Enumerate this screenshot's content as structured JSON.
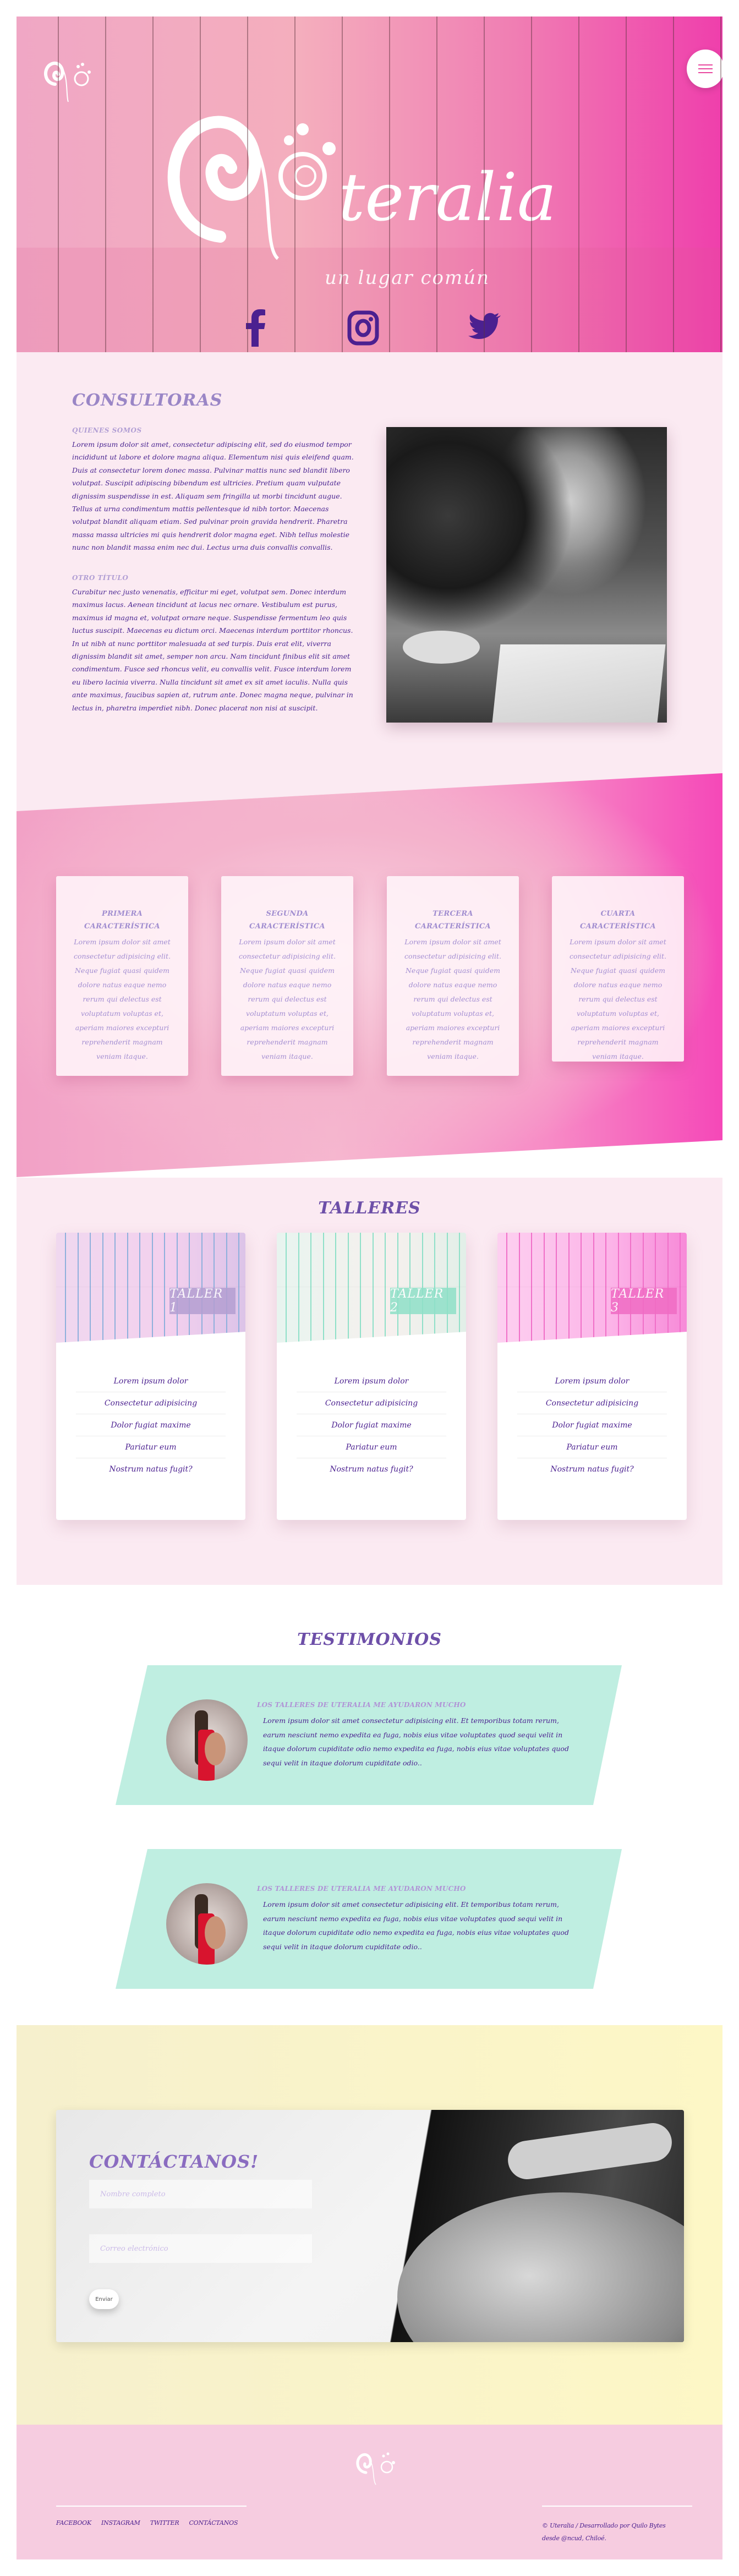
{
  "colors": {
    "accent_purple": "#4a1f8f",
    "heading_lilac": "#9a86c6",
    "hero_pink": "#ef3fac",
    "mint": "#bfeee1",
    "footer_pink": "#f6cce0"
  },
  "hero": {
    "brand": "teralia",
    "tagline": "un lugar común",
    "menu_icon": "hamburger-icon",
    "social": [
      {
        "icon": "facebook-icon"
      },
      {
        "icon": "instagram-icon"
      },
      {
        "icon": "twitter-icon"
      }
    ]
  },
  "consultoras": {
    "title": "CONSULTORAS",
    "sub1": "QUIENES SOMOS",
    "p1": "Lorem ipsum dolor sit amet, consectetur adipiscing elit, sed do eiusmod tempor incididunt ut labore et dolore magna aliqua. Elementum nisi quis eleifend quam. Duis at consectetur lorem donec massa. Pulvinar mattis nunc sed blandit libero volutpat. Suscipit adipiscing bibendum est ultricies. Pretium quam vulputate dignissim suspendisse in est. Aliquam sem fringilla ut morbi tincidunt augue. Tellus at urna condimentum mattis pellentesque id nibh tortor. Maecenas volutpat blandit aliquam etiam. Sed pulvinar proin gravida hendrerit. Pharetra massa massa ultricies mi quis hendrerit dolor magna eget. Nibh tellus molestie nunc non blandit massa enim nec dui. Lectus urna duis convallis convallis.",
    "sub2": "OTRO TÍTULO",
    "p2": "Curabitur nec justo venenatis, efficitur mi eget, volutpat sem. Donec interdum maximus lacus. Aenean tincidunt at lacus nec ornare. Vestibulum est purus, maximus id magna et, volutpat ornare neque. Suspendisse fermentum leo quis luctus suscipit. Maecenas eu dictum orci. Maecenas interdum porttitor rhoncus. In ut nibh at nunc porttitor malesuada at sed turpis. Duis erat elit, viverra dignissim blandit sit amet, semper non arcu. Nam tincidunt finibus elit sit amet condimentum. Fusce sed rhoncus velit, eu convallis velit. Fusce interdum lorem eu libero lacinia viverra. Nulla tincidunt sit amet ex sit amet iaculis. Nulla quis ante maximus, faucibus sapien at, rutrum ante. Donec magna neque, pulvinar in lectus in, pharetra imperdiet nibh. Donec placerat non nisi at suscipit."
  },
  "features": [
    {
      "title": "PRIMERA CARACTERÍSTICA",
      "text": "Lorem ipsum dolor sit amet consectetur adipisicing elit. Neque fugiat quasi quidem dolore natus eaque nemo rerum qui delectus est voluptatum voluptas et, aperiam maiores excepturi reprehenderit magnam veniam itaque."
    },
    {
      "title": "SEGUNDA CARACTERÍSTICA",
      "text": "Lorem ipsum dolor sit amet consectetur adipisicing elit. Neque fugiat quasi quidem dolore natus eaque nemo rerum qui delectus est voluptatum voluptas et, aperiam maiores excepturi reprehenderit magnam veniam itaque."
    },
    {
      "title": "TERCERA CARACTERÍSTICA",
      "text": "Lorem ipsum dolor sit amet consectetur adipisicing elit. Neque fugiat quasi quidem dolore natus eaque nemo rerum qui delectus est voluptatum voluptas et, aperiam maiores excepturi reprehenderit magnam veniam itaque."
    },
    {
      "title": "CUARTA CARACTERÍSTICA",
      "text": "Lorem ipsum dolor sit amet consectetur adipisicing elit. Neque fugiat quasi quidem dolore natus eaque nemo rerum qui delectus est voluptatum voluptas et, aperiam maiores excepturi reprehenderit magnam veniam itaque."
    }
  ],
  "talleres": {
    "title": "TALLERES",
    "cards": [
      {
        "label": "TALLER 1",
        "color": "#b49fd2",
        "items": [
          "Lorem ipsum dolor",
          "Consectetur adipisicing",
          "Dolor fugiat maxime",
          "Pariatur eum",
          "Nostrum natus fugit?"
        ]
      },
      {
        "label": "TALLER 2",
        "color": "#8fe0c8",
        "items": [
          "Lorem ipsum dolor",
          "Consectetur adipisicing",
          "Dolor fugiat maxime",
          "Pariatur eum",
          "Nostrum natus fugit?"
        ]
      },
      {
        "label": "TALLER 3",
        "color": "#f06cc4",
        "items": [
          "Lorem ipsum dolor",
          "Consectetur adipisicing",
          "Dolor fugiat maxime",
          "Pariatur eum",
          "Nostrum natus fugit?"
        ]
      }
    ]
  },
  "testimonios": {
    "title": "TESTIMONIOS",
    "items": [
      {
        "title": "LOS TALLERES DE UTERALIA ME AYUDARON MUCHO",
        "text": "Lorem ipsum dolor sit amet consectetur adipisicing elit. Et temporibus totam rerum, earum nesciunt nemo expedita ea fuga, nobis eius vitae voluptates quod sequi velit in itaque dolorum cupiditate odio nemo expedita ea fuga, nobis eius vitae voluptates quod sequi velit in itaque dolorum cupiditate odio.."
      },
      {
        "title": "LOS TALLERES DE UTERALIA ME AYUDARON MUCHO",
        "text": "Lorem ipsum dolor sit amet consectetur adipisicing elit. Et temporibus totam rerum, earum nesciunt nemo expedita ea fuga, nobis eius vitae voluptates quod sequi velit in itaque dolorum cupiditate odio nemo expedita ea fuga, nobis eius vitae voluptates quod sequi velit in itaque dolorum cupiditate odio.."
      }
    ]
  },
  "contact": {
    "title": "CONTÁCTANOS!",
    "name_placeholder": "Nombre completo",
    "email_placeholder": "Correo electrónico",
    "submit": "Enviar"
  },
  "footer": {
    "links": [
      "FACEBOOK",
      "INSTAGRAM",
      "TWITTER",
      "CONTÁCTANOS"
    ],
    "copyright_1": "© Uteralia / Desarrollado por Quilo Bytes",
    "copyright_2": "desde @ncud, Chiloé."
  }
}
